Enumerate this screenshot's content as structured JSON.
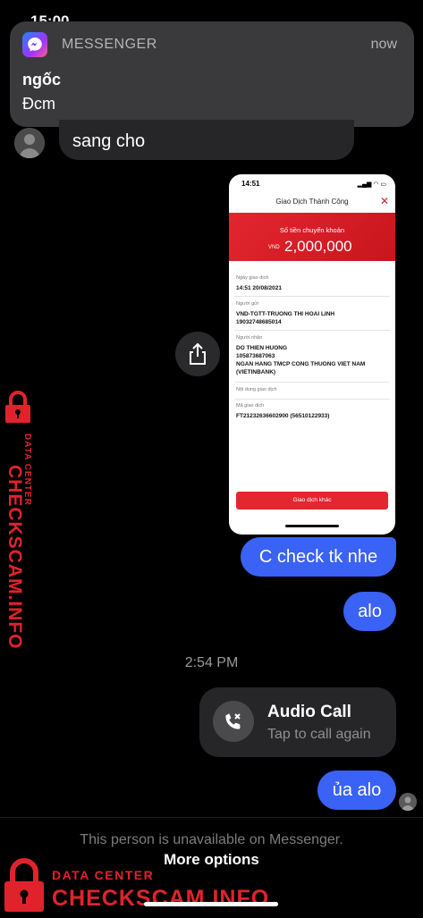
{
  "status_bar": {
    "time": "15:00"
  },
  "notification": {
    "app_name": "MESSENGER",
    "time": "now",
    "sender": "ngốc",
    "message": "Đcm"
  },
  "chat": {
    "incoming": {
      "text": "sang cho"
    },
    "shared_image": {
      "status_time": "14:51",
      "status_icons": "▂▄▆ ◠ ▭",
      "title": "Giao Dịch Thành Công",
      "amount_label": "Số tiền chuyển khoản",
      "currency": "VND",
      "amount": "2,000,000",
      "fields": [
        {
          "label": "Ngày giao dịch",
          "value": "14:51 20/08/2021"
        },
        {
          "label": "Người gửi",
          "value": "VND-TGTT-TRUONG THI HOAI LINH\n19032748685014"
        },
        {
          "label": "Người nhận",
          "value": "DO THIEN HUONG\n105873687063\nNGAN HANG TMCP CONG THUONG VIET NAM\n(VIETINBANK)"
        },
        {
          "label": "Nội dung giao dịch",
          "value": ""
        },
        {
          "label": "Mã giao dịch",
          "value": "FT21232636602900 (56510122933)"
        }
      ],
      "button_label": "Giao dịch khác"
    },
    "outgoing": [
      "C check tk nhe",
      "alo",
      "ủa alo"
    ],
    "timestamp": "2:54 PM",
    "call": {
      "title": "Audio Call",
      "subtitle": "Tap to call again"
    }
  },
  "footer": {
    "unavailable_text": "This person is unavailable on Messenger.",
    "more_options": "More options"
  },
  "watermark": {
    "sub": "DATA CENTER",
    "main": "CHECKSCAM.INFO",
    "color": "#e0232b"
  },
  "colors": {
    "outgoing_bubble": "#3a62f5",
    "incoming_bubble": "#262628",
    "receipt_accent": "#e3262f"
  }
}
